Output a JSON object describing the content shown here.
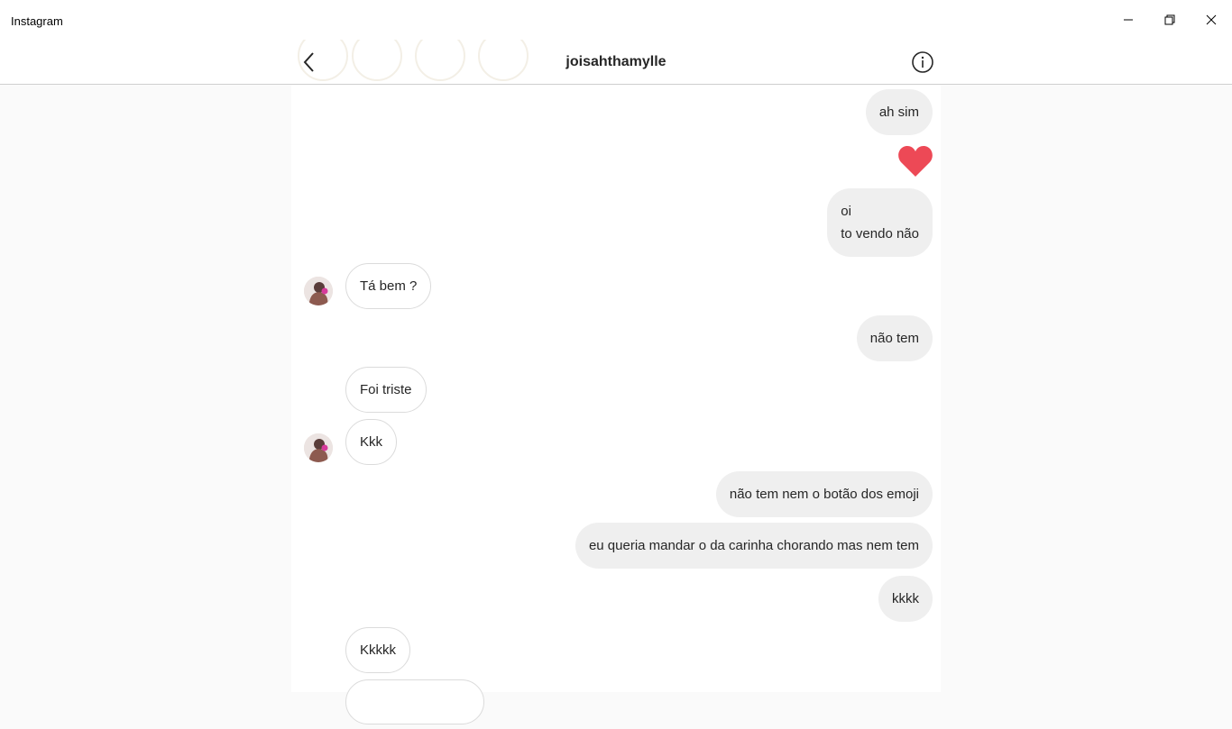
{
  "window": {
    "title": "Instagram",
    "minimize_icon": "minimize-icon",
    "maximize_icon": "restore-icon",
    "close_icon": "close-icon"
  },
  "header": {
    "username": "joisahthamylle",
    "back_icon": "chevron-left-icon",
    "info_icon": "info-icon"
  },
  "colors": {
    "sent_bubble": "#efefef",
    "received_border": "#dbdbdb",
    "heart": "#ed4956"
  },
  "messages": [
    {
      "side": "sent",
      "text": "ah sim"
    },
    {
      "side": "sent",
      "reaction": "heart-icon"
    },
    {
      "side": "sent",
      "lines": [
        "oi",
        "to vendo não"
      ]
    },
    {
      "side": "received",
      "text": "Tá bem ?"
    },
    {
      "side": "sent",
      "text": "não tem"
    },
    {
      "side": "received",
      "text": "Foi triste"
    },
    {
      "side": "received",
      "text": "Kkk"
    },
    {
      "side": "sent",
      "text": "não tem nem o botão dos emoji"
    },
    {
      "side": "sent",
      "text": "eu queria mandar o da carinha chorando mas nem tem"
    },
    {
      "side": "sent",
      "text": "kkkk"
    },
    {
      "side": "received",
      "text": "Kkkkk"
    }
  ]
}
